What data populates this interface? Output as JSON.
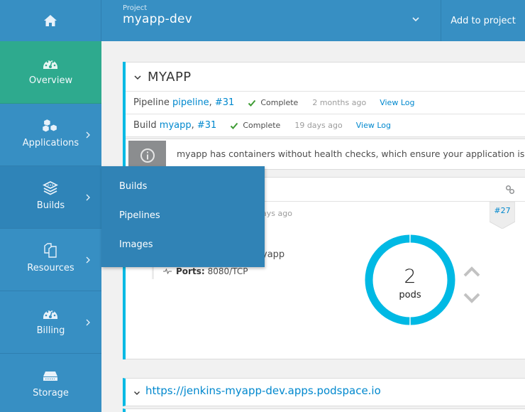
{
  "header": {
    "home_icon": "home-icon",
    "project_label": "Project",
    "project_name": "myapp-dev",
    "project_dropdown_icon": "chevron-down-icon",
    "add_to_project": "Add to project"
  },
  "sidebar": {
    "items": [
      {
        "label": "Overview",
        "icon": "dashboard-icon",
        "active": true
      },
      {
        "label": "Applications",
        "icon": "cubes-icon",
        "has_submenu": true
      },
      {
        "label": "Builds",
        "icon": "layers-icon",
        "has_submenu": true,
        "hovered": true
      },
      {
        "label": "Resources",
        "icon": "files-icon",
        "has_submenu": true
      },
      {
        "label": "Billing",
        "icon": "gauge-icon",
        "has_submenu": true
      },
      {
        "label": "Storage",
        "icon": "storage-icon"
      }
    ],
    "flyout": {
      "parent": "Builds",
      "items": [
        "Builds",
        "Pipelines",
        "Images"
      ]
    }
  },
  "main": {
    "app": {
      "title": "MYAPP",
      "pipeline": {
        "kind": "Pipeline",
        "name": "pipeline",
        "number": "#31",
        "status": "Complete",
        "ago": "2 months ago",
        "log_link": "View Log"
      },
      "build": {
        "kind": "Build",
        "name": "myapp",
        "number": "#31",
        "status": "Complete",
        "ago": "19 days ago",
        "log_link": "View Log"
      },
      "alert": {
        "icon": "info-icon",
        "text": "myapp has containers without health checks, which ensure your application is running correctly."
      },
      "deployment": {
        "ago_partial": "ays ago",
        "image_partial": "yapp",
        "ports_label": "Ports:",
        "ports_value": "8080/TCP",
        "revision": "#27",
        "pods_count": "2",
        "pods_label": "pods",
        "pods_running_fraction": 1.0
      }
    },
    "route": {
      "url": "https://jenkins-myapp-dev.apps.podspace.io"
    }
  },
  "colors": {
    "header_blue": "#378fc3",
    "active_green": "#2eaa8e",
    "flyout_blue": "#3083b6",
    "card_accent": "#00b9e4",
    "link_blue": "#0088ce",
    "success_green": "#3f9c35"
  }
}
